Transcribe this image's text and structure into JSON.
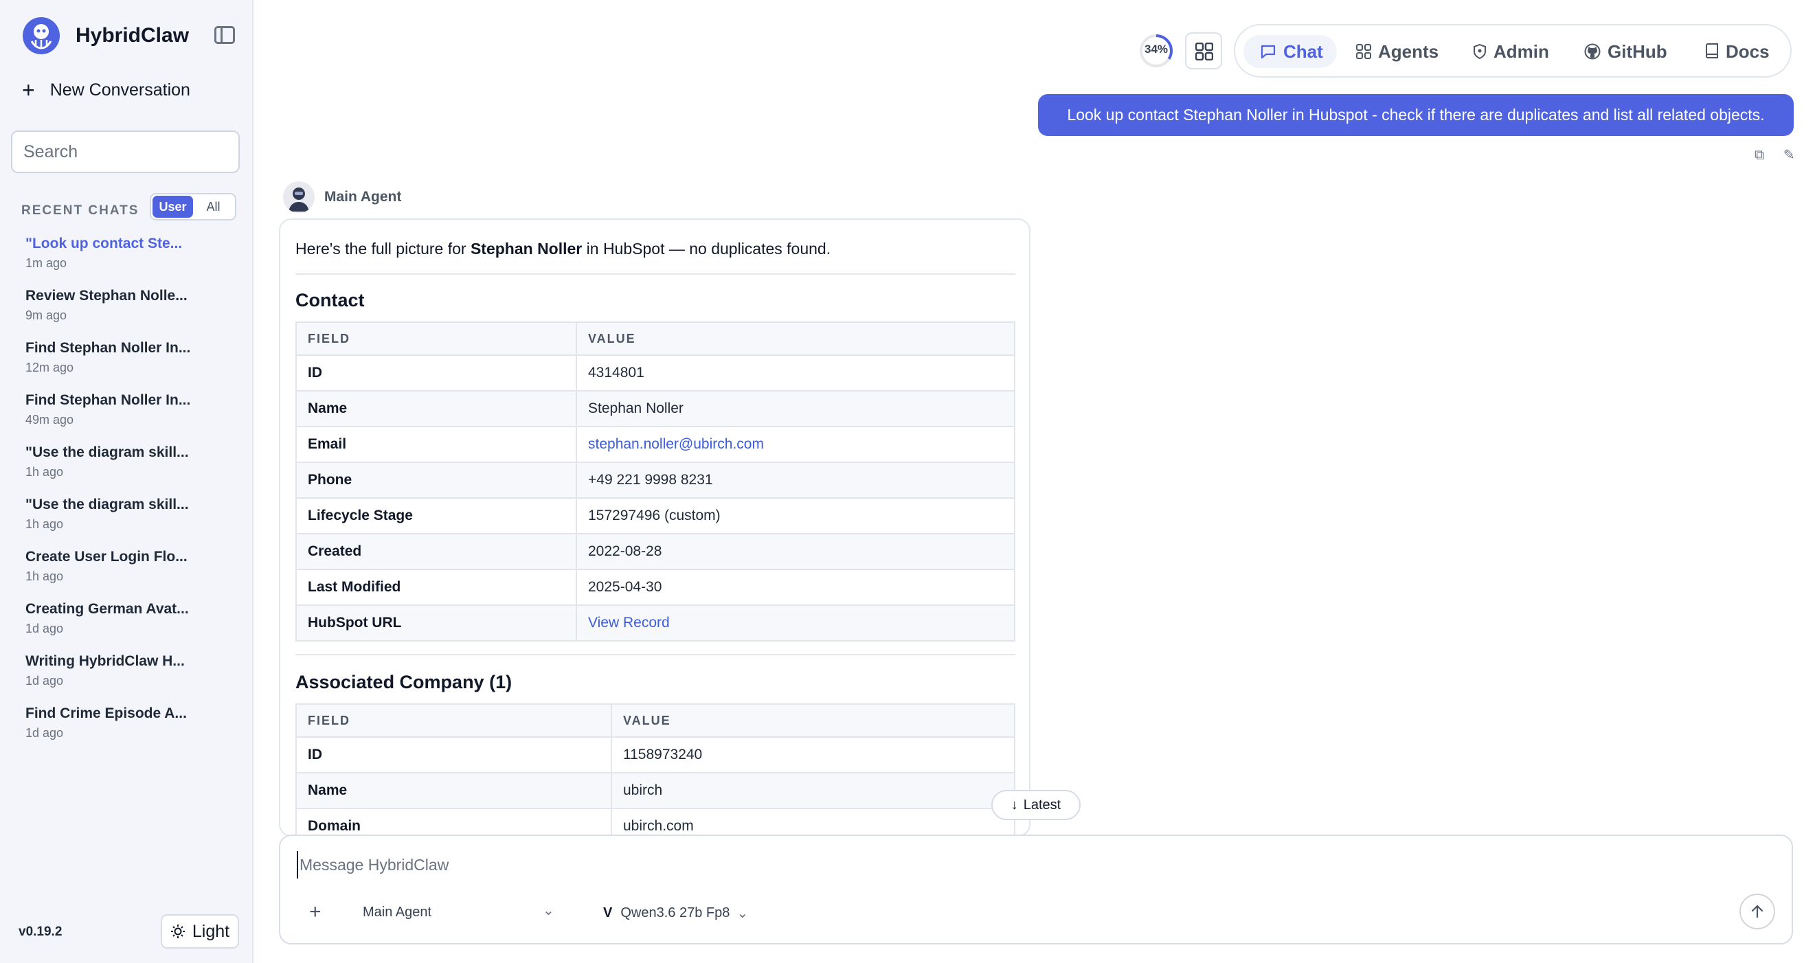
{
  "app": {
    "name": "HybridClaw",
    "version": "v0.19.2"
  },
  "sidebar": {
    "new_conversation": "New Conversation",
    "search_placeholder": "Search",
    "recent_label": "RECENT CHATS",
    "filter": {
      "user": "User",
      "all": "All",
      "selected": "User"
    },
    "chats": [
      {
        "title": "\"Look up contact Ste...",
        "time": "1m ago",
        "current": true
      },
      {
        "title": "Review Stephan Nolle...",
        "time": "9m ago"
      },
      {
        "title": "Find Stephan Noller In...",
        "time": "12m ago"
      },
      {
        "title": "Find Stephan Noller In...",
        "time": "49m ago"
      },
      {
        "title": "\"Use the diagram skill...",
        "time": "1h ago"
      },
      {
        "title": "\"Use the diagram skill...",
        "time": "1h ago"
      },
      {
        "title": "Create User Login Flo...",
        "time": "1h ago"
      },
      {
        "title": "Creating German Avat...",
        "time": "1d ago"
      },
      {
        "title": "Writing HybridClaw H...",
        "time": "1d ago"
      },
      {
        "title": "Find Crime Episode A...",
        "time": "1d ago"
      }
    ],
    "theme_label": "Light"
  },
  "topbar": {
    "context_usage": "34%",
    "context_fraction": 0.34,
    "nav": [
      {
        "label": "Chat",
        "icon": "chat-icon",
        "active": true
      },
      {
        "label": "Agents",
        "icon": "agents-grid-icon"
      },
      {
        "label": "Admin",
        "icon": "admin-shield-icon"
      },
      {
        "label": "GitHub",
        "icon": "github-icon"
      },
      {
        "label": "Docs",
        "icon": "docs-book-icon"
      }
    ]
  },
  "conversation": {
    "user_message": "Look up contact Stephan Noller in Hubspot - check if there are duplicates and list all related objects.",
    "agent_name": "Main Agent",
    "reply": {
      "intro_pre": "Here's the full picture for ",
      "intro_bold": "Stephan Noller",
      "intro_post": " in HubSpot — no duplicates found.",
      "contact_title": "Contact",
      "company_title": "Associated Company (1)",
      "col_field": "FIELD",
      "col_value": "VALUE",
      "contact_rows": [
        {
          "field": "ID",
          "value": "4314801"
        },
        {
          "field": "Name",
          "value": "Stephan Noller"
        },
        {
          "field": "Email",
          "value": "stephan.noller@ubirch.com",
          "link": true
        },
        {
          "field": "Phone",
          "value": "+49 221 9998 8231"
        },
        {
          "field": "Lifecycle Stage",
          "value": "157297496 (custom)"
        },
        {
          "field": "Created",
          "value": "2022-08-28"
        },
        {
          "field": "Last Modified",
          "value": "2025-04-30"
        },
        {
          "field": "HubSpot URL",
          "value": "View Record",
          "link": true
        }
      ],
      "company_rows": [
        {
          "field": "ID",
          "value": "1158973240"
        },
        {
          "field": "Name",
          "value": "ubirch"
        },
        {
          "field": "Domain",
          "value": "ubirch.com"
        }
      ]
    },
    "latest_label": "Latest"
  },
  "composer": {
    "placeholder": "Message HybridClaw",
    "agent": "Main Agent",
    "model": "Qwen3.6 27b Fp8"
  },
  "colors": {
    "accent": "#4f63e0",
    "link": "#3b5bdb"
  }
}
